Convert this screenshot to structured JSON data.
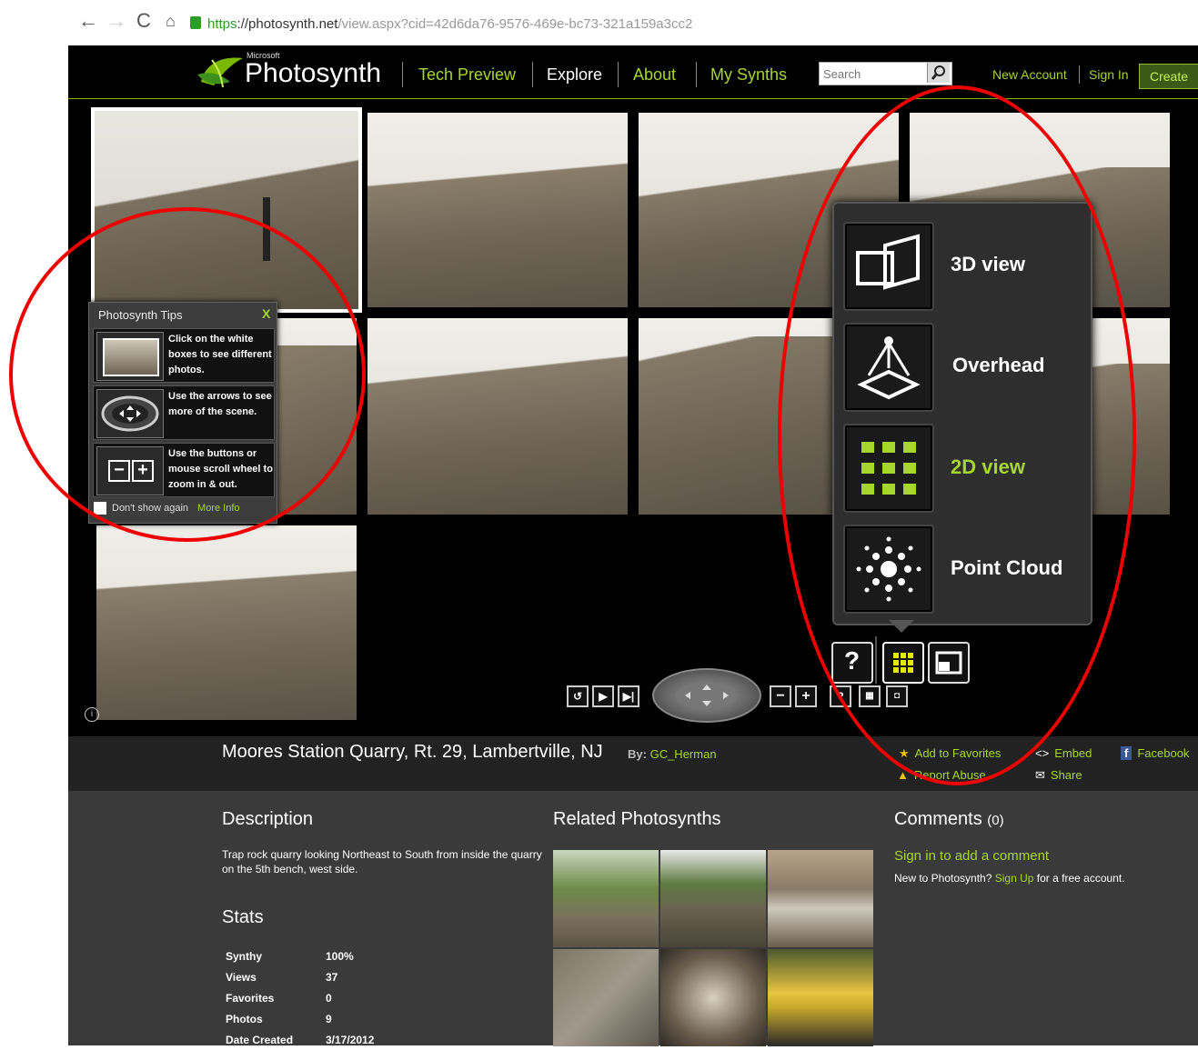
{
  "browser": {
    "url_scheme": "https",
    "url_host": "://photosynth.net",
    "url_path": "/view.aspx?cid=42d6da76-9576-469e-bc73-321a159a3cc2"
  },
  "header": {
    "brand_small": "Microsoft",
    "brand": "Photosynth",
    "nav": [
      "Tech Preview",
      "Explore",
      "About",
      "My Synths"
    ],
    "search_placeholder": "Search",
    "new_account": "New Account",
    "sign_in": "Sign In",
    "create": "Create"
  },
  "tips": {
    "title": "Photosynth Tips",
    "close": "X",
    "rows": [
      "Click on the white boxes to see different photos.",
      "Use the arrows to see more of the scene.",
      "Use the buttons or mouse scroll wheel to zoom in & out."
    ],
    "dont_show": "Don't show again",
    "more_info": "More Info"
  },
  "view_menu": {
    "items": [
      {
        "label": "3D view",
        "icon": "3d-view-icon"
      },
      {
        "label": "Overhead",
        "icon": "overhead-icon"
      },
      {
        "label": "2D view",
        "icon": "2d-view-icon"
      },
      {
        "label": "Point Cloud",
        "icon": "point-cloud-icon"
      }
    ],
    "help": "?"
  },
  "synth": {
    "title": "Moores Station Quarry, Rt. 29, Lambertville, NJ",
    "by_label": "By:",
    "author": "GC_Herman",
    "actions": {
      "favorites": "Add to Favorites",
      "embed": "Embed",
      "facebook": "Facebook",
      "report": "Report Abuse",
      "share": "Share"
    }
  },
  "description": {
    "heading": "Description",
    "text": "Trap rock quarry looking Northeast to South from inside the quarry on the 5th bench, west side."
  },
  "stats": {
    "heading": "Stats",
    "rows": [
      {
        "k": "Synthy",
        "v": "100%"
      },
      {
        "k": "Views",
        "v": "37"
      },
      {
        "k": "Favorites",
        "v": "0"
      },
      {
        "k": "Photos",
        "v": "9"
      },
      {
        "k": "Date Created",
        "v": "3/17/2012"
      }
    ]
  },
  "related": {
    "heading": "Related Photosynths"
  },
  "comments": {
    "heading": "Comments",
    "count": "(0)",
    "signin": "Sign in to add a comment",
    "newto_prefix": "New to Photosynth?",
    "signup": "Sign Up",
    "newto_suffix": "for a free account."
  },
  "colors": {
    "accent": "#a6d62c",
    "highlight_ring": "#e00000"
  }
}
